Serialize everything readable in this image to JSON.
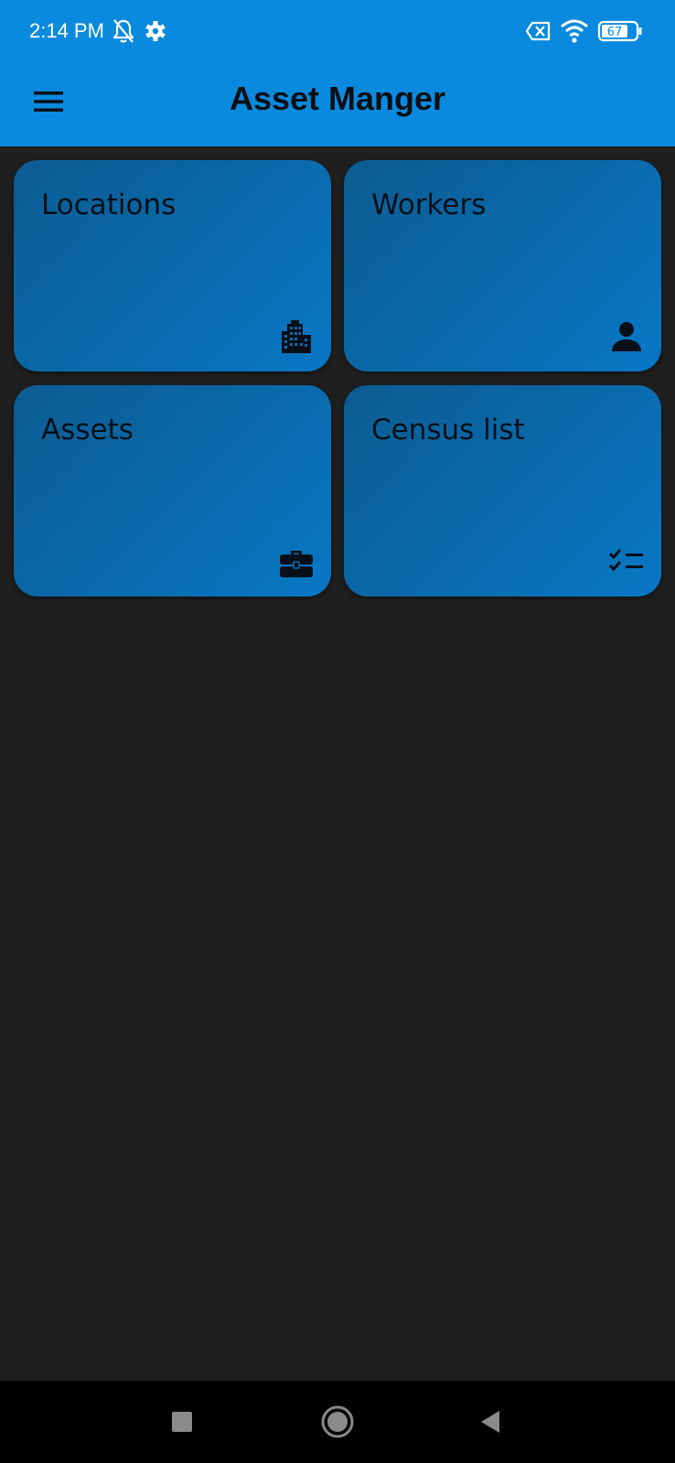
{
  "status_bar": {
    "time": "2:14 PM",
    "icons": [
      "bell-off-icon",
      "settings-gear-icon",
      "no-sim-icon",
      "wifi-icon",
      "battery-icon"
    ],
    "battery_level": "67"
  },
  "app_bar": {
    "title": "Asset Manger",
    "menu_icon": "hamburger-menu-icon",
    "background_color": "#0a8ade"
  },
  "cards": [
    {
      "label": "Locations",
      "icon": "building-icon"
    },
    {
      "label": "Workers",
      "icon": "person-icon"
    },
    {
      "label": "Assets",
      "icon": "briefcase-icon"
    },
    {
      "label": "Census list",
      "icon": "checklist-icon"
    }
  ],
  "nav_bar": {
    "buttons": [
      "recents-square-icon",
      "home-circle-icon",
      "back-triangle-icon"
    ]
  },
  "colors": {
    "background": "#1f1f1f",
    "card": "#0a6aad",
    "accent": "#0a8ade"
  }
}
